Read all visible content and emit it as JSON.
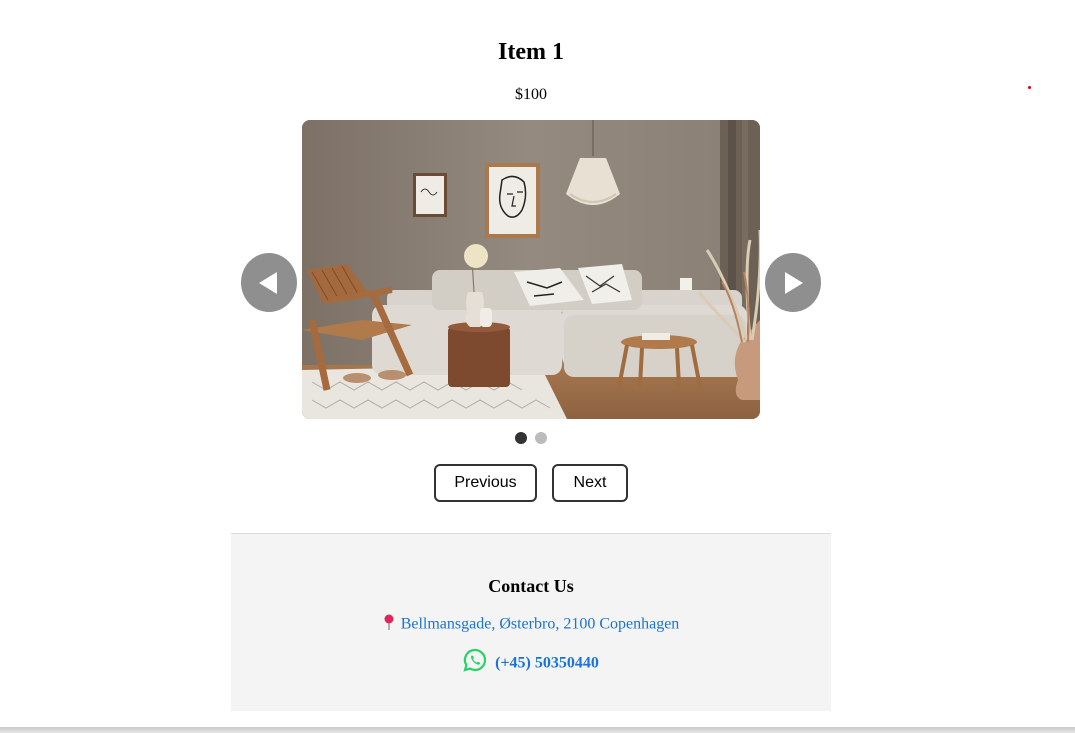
{
  "product": {
    "title": "Item 1",
    "price": "$100",
    "image_description": "living-room-photo"
  },
  "carousel": {
    "prev_arrow_icon": "triangle-left-icon",
    "next_arrow_icon": "triangle-right-icon",
    "slide_count": 2,
    "active_slide": 1
  },
  "buttons": {
    "previous_label": "Previous",
    "next_label": "Next"
  },
  "contact": {
    "heading": "Contact Us",
    "address": "Bellmansgade, Østerbro, 2100 Copenhagen",
    "address_icon": "map-pin-icon",
    "phone": "(+45) 50350440",
    "phone_icon": "whatsapp-icon"
  },
  "colors": {
    "link": "#1a73d9",
    "arrow_bg": "#8f8f8f",
    "dot_active": "#333333",
    "dot_inactive": "#bbbbbb",
    "contact_bg": "#f4f4f4",
    "whatsapp": "#25d366",
    "pin": "#e0245e"
  }
}
